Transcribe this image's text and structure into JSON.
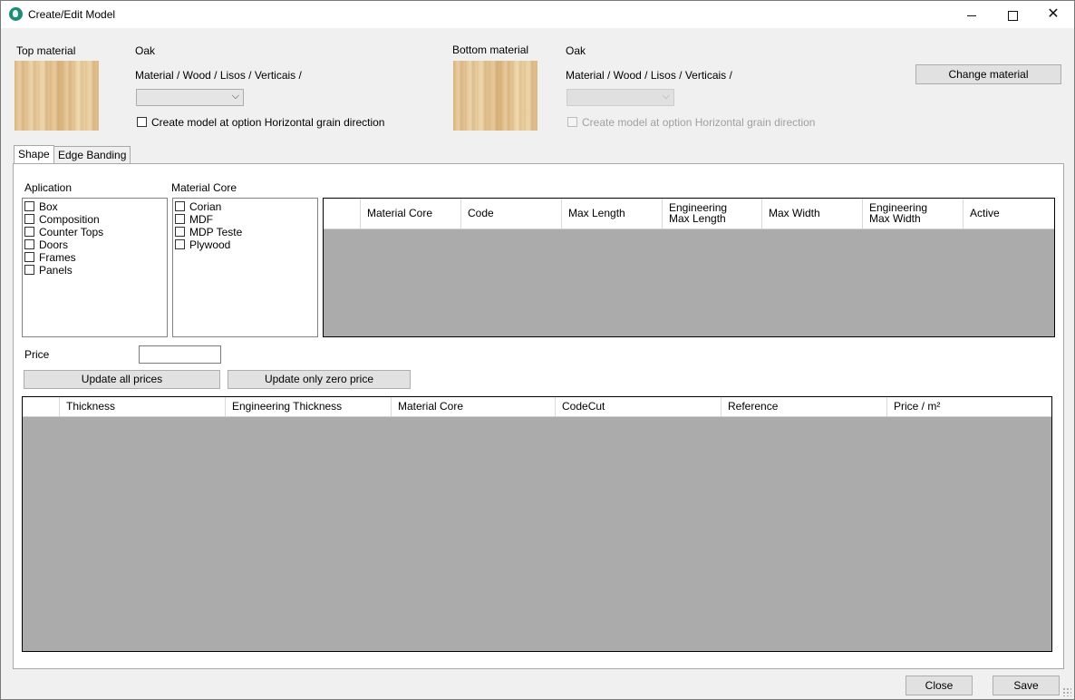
{
  "window": {
    "title": "Create/Edit Model"
  },
  "top": {
    "label": "Top material",
    "material_name": "Oak",
    "path": "Material / Wood / Lisos / Verticais /",
    "combo_value": "",
    "checkbox_label": "Create model at option Horizontal grain direction"
  },
  "bottom": {
    "label": "Bottom material",
    "material_name": "Oak",
    "path": "Material / Wood / Lisos / Verticais /",
    "combo_value": "",
    "checkbox_label": "Create model at option Horizontal grain direction"
  },
  "change_material_label": "Change material",
  "tabs": [
    {
      "label": "Shape",
      "active": true
    },
    {
      "label": "Edge Banding",
      "active": false
    }
  ],
  "aplication": {
    "label": "Aplication",
    "items": [
      "Box",
      "Composition",
      "Counter Tops",
      "Doors",
      "Frames",
      "Panels"
    ]
  },
  "material_core": {
    "label": "Material Core",
    "items": [
      "Corian",
      "MDF",
      "MDP Teste",
      "Plywood"
    ]
  },
  "core_grid": {
    "columns": [
      "Material Core",
      "Code",
      "Max Length",
      "Engineering\nMax Length",
      "Max Width",
      "Engineering Max Width",
      "Active"
    ]
  },
  "price": {
    "label": "Price",
    "value": ""
  },
  "update_all_label": "Update all prices",
  "update_zero_label": "Update only zero price",
  "thickness_grid": {
    "columns": [
      "Thickness",
      "Engineering Thickness",
      "Material Core",
      "CodeCut",
      "Reference",
      "Price / m²"
    ]
  },
  "footer": {
    "close_label": "Close",
    "save_label": "Save"
  }
}
